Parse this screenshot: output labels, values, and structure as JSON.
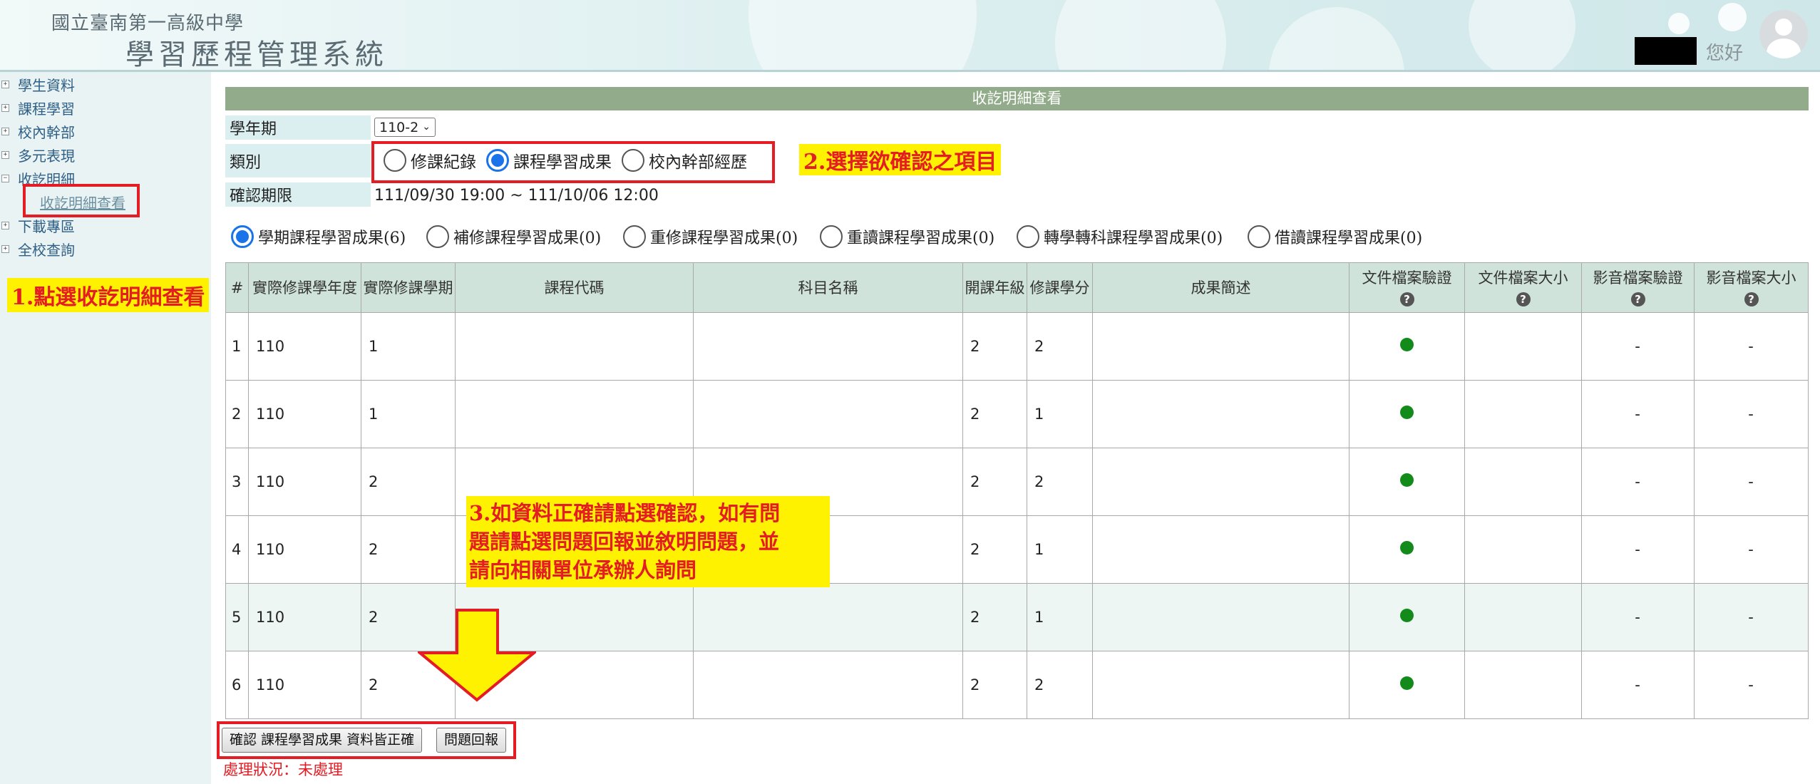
{
  "header": {
    "school_name": "國立臺南第一高級中學",
    "system_name": "學習歷程管理系統",
    "greeting": "您好"
  },
  "sidebar": {
    "items": [
      {
        "label": "學生資料",
        "expander": "+"
      },
      {
        "label": "課程學習",
        "expander": "+"
      },
      {
        "label": "校內幹部",
        "expander": "+"
      },
      {
        "label": "多元表現",
        "expander": "+"
      },
      {
        "label": "收訖明細",
        "expander": "−"
      },
      {
        "label": "下載專區",
        "expander": "+"
      },
      {
        "label": "全校查詢",
        "expander": "+"
      }
    ],
    "sub_item": "收訖明細查看"
  },
  "annotations": {
    "step1": "1.點選收訖明細查看",
    "step2": "2.選擇欲確認之項目",
    "step3_lines": [
      "3.如資料正確請點選確認，如有問",
      "題請點選問題回報並敘明問題，並",
      "請向相關單位承辦人詢問"
    ]
  },
  "panel": {
    "title": "收訖明細查看",
    "term_label": "學年期",
    "term_value": "110-2",
    "category_label": "類別",
    "category_options": [
      {
        "label": "修課紀錄",
        "checked": false
      },
      {
        "label": "課程學習成果",
        "checked": true
      },
      {
        "label": "校內幹部經歷",
        "checked": false
      }
    ],
    "deadline_label": "確認期限",
    "deadline_value": "111/09/30 19:00 ~ 111/10/06 12:00"
  },
  "subtabs": [
    {
      "label": "學期課程學習成果(6)",
      "checked": true
    },
    {
      "label": "補修課程學習成果(0)",
      "checked": false
    },
    {
      "label": "重修課程學習成果(0)",
      "checked": false
    },
    {
      "label": "重讀課程學習成果(0)",
      "checked": false
    },
    {
      "label": "轉學轉科課程學習成果(0)",
      "checked": false
    },
    {
      "label": "借讀課程學習成果(0)",
      "checked": false
    }
  ],
  "table": {
    "headers": [
      "#",
      "實際修課學年度",
      "實際修課學期",
      "課程代碼",
      "科目名稱",
      "開課年級",
      "修課學分",
      "成果簡述",
      "文件檔案驗證",
      "文件檔案大小",
      "影音檔案驗證",
      "影音檔案大小"
    ],
    "rows": [
      [
        "1",
        "110",
        "1",
        "",
        "",
        "2",
        "2",
        "",
        "",
        "",
        "-",
        "-"
      ],
      [
        "2",
        "110",
        "1",
        "",
        "",
        "2",
        "1",
        "",
        "",
        "",
        "-",
        "-"
      ],
      [
        "3",
        "110",
        "2",
        "",
        "",
        "2",
        "2",
        "",
        "",
        "",
        "-",
        "-"
      ],
      [
        "4",
        "110",
        "2",
        "",
        "",
        "2",
        "1",
        "",
        "",
        "",
        "-",
        "-"
      ],
      [
        "5",
        "110",
        "2",
        "",
        "",
        "2",
        "1",
        "",
        "",
        "",
        "-",
        "-"
      ],
      [
        "6",
        "110",
        "2",
        "",
        "",
        "2",
        "2",
        "",
        "",
        "",
        "-",
        "-"
      ]
    ],
    "verified_color": "#128b1b"
  },
  "buttons": {
    "confirm": "確認 課程學習成果 資料皆正確",
    "report": "問題回報"
  },
  "status": {
    "label": "處理狀況：",
    "value": "未處理"
  },
  "colors": {
    "accent_red": "#e41c24",
    "highlight_yellow": "#fff200",
    "panel_title_bg": "#92ab8a",
    "radio_blue": "#1a73e8"
  }
}
